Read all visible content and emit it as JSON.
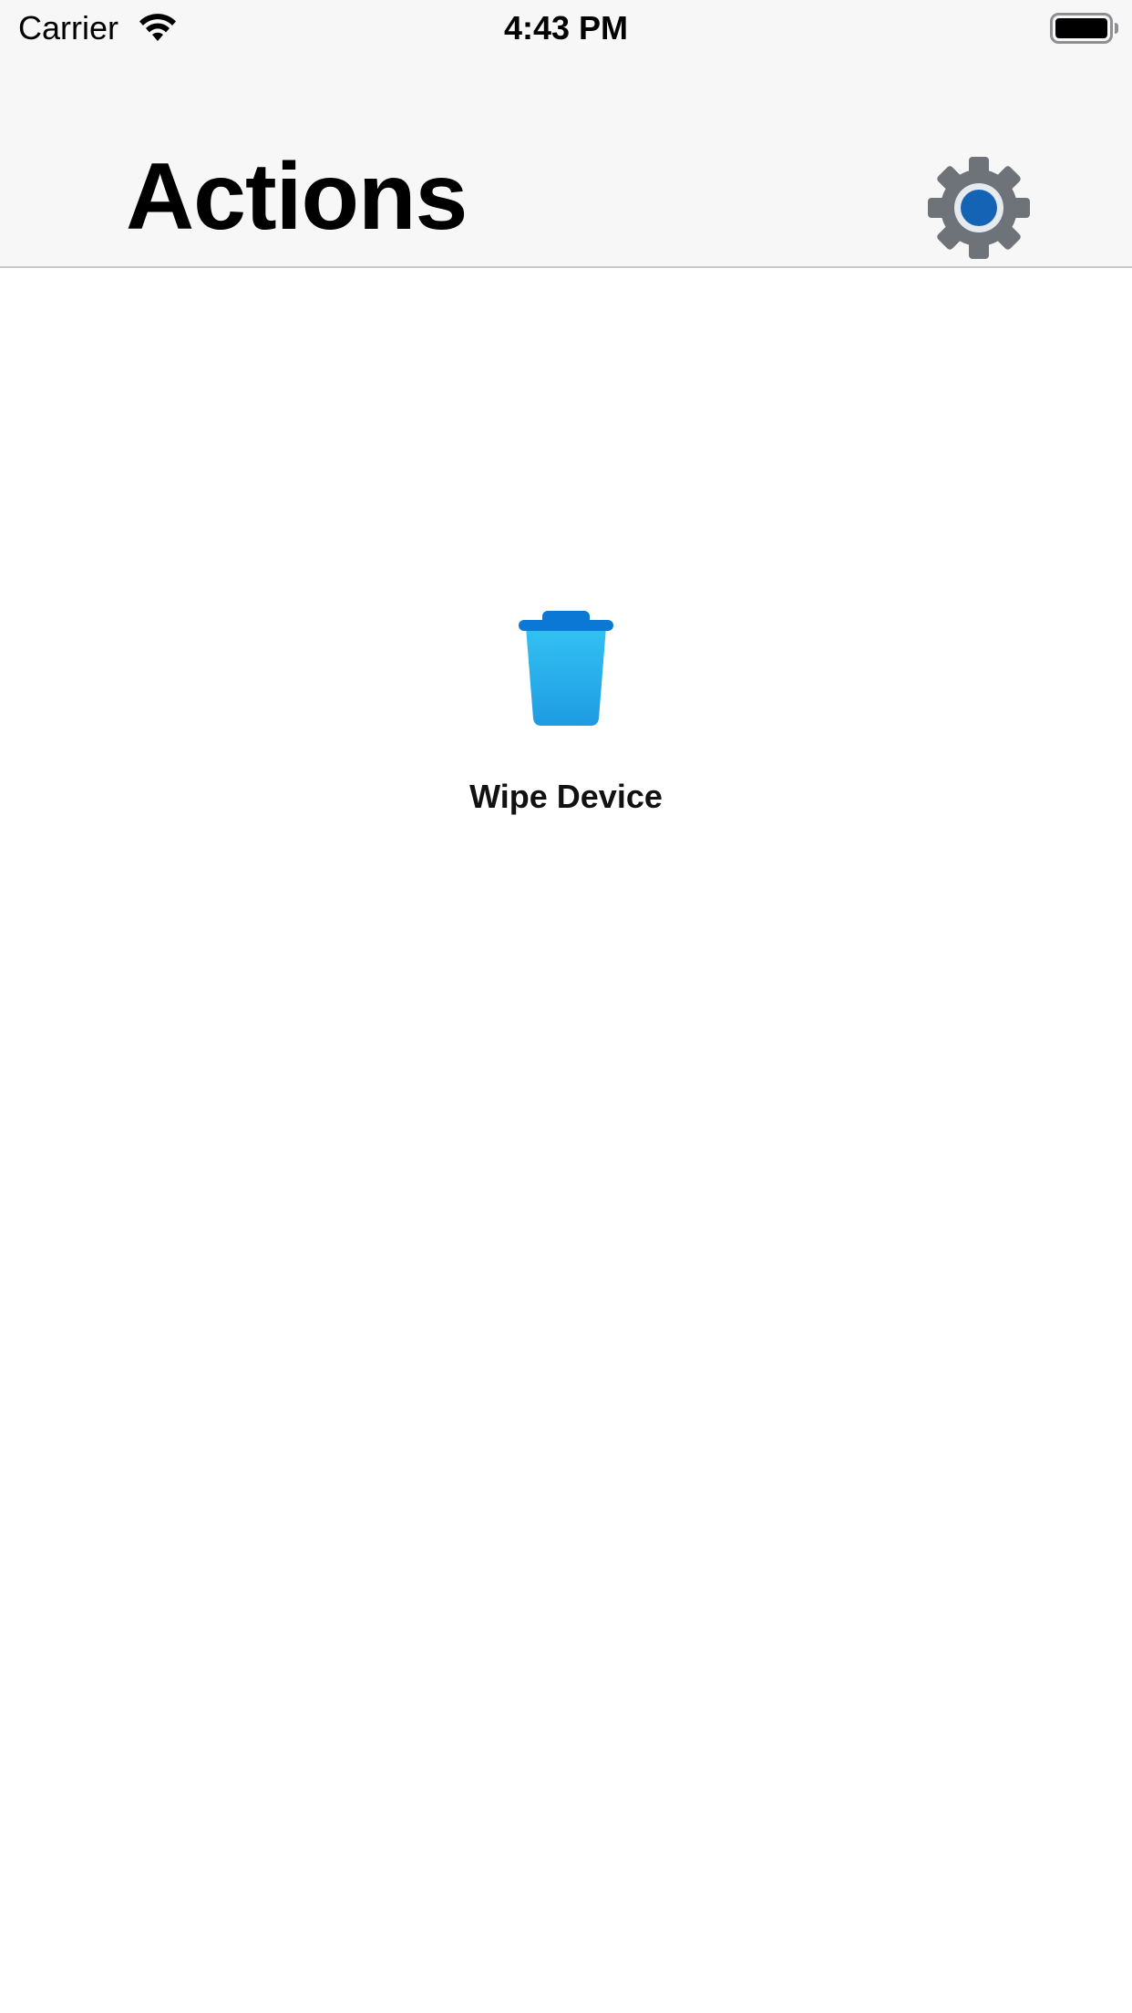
{
  "status_bar": {
    "carrier": "Carrier",
    "time": "4:43 PM",
    "icons": [
      "wifi-icon",
      "battery-icon"
    ]
  },
  "header": {
    "title": "Actions",
    "settings_icon": "gear-icon"
  },
  "actions": [
    {
      "label": "Wipe Device",
      "icon": "trash-icon"
    }
  ],
  "colors": {
    "header_background": "#f7f7f7",
    "gear_gray": "#6e737a",
    "gear_center_blue": "#1463b4",
    "trash_blue": "#2aaee8",
    "trash_lid_blue": "#0a78d4"
  }
}
